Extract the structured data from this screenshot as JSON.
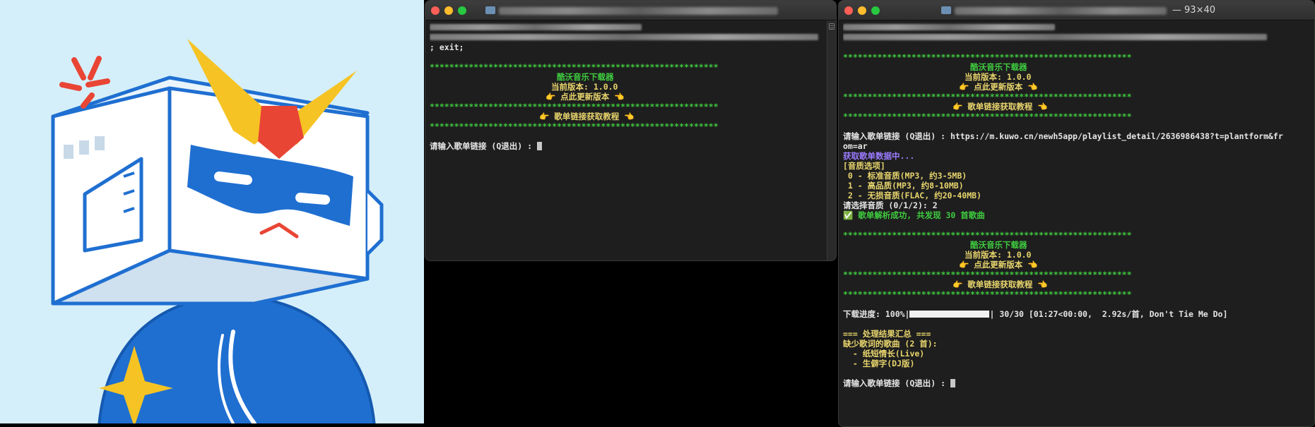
{
  "terminal_left": {
    "prev_command_tail": "; exit;",
    "banner": {
      "stars": "***********************************************************",
      "app_name": "酷沃音乐下载器",
      "version_line": "当前版本: 1.0.0",
      "update_link": "👉 点此更新版本 👈",
      "tutorial_link": "👉 歌单链接获取教程 👈"
    },
    "prompt": "请输入歌单链接 (Q退出) : "
  },
  "terminal_right": {
    "size_label": "— 93×40",
    "banner": {
      "stars": "***********************************************************",
      "app_name": "酷沃音乐下载器",
      "version_line": "当前版本: 1.0.0",
      "update_link": "👉 点此更新版本 👈",
      "tutorial_link": "👉 歌单链接获取教程 👈"
    },
    "prompt_with_url": "请输入歌单链接 (Q退出) : https://m.kuwo.cn/newh5app/playlist_detail/2636986438?t=plantform&fr",
    "url_wrap": "om=ar",
    "fetching": "获取歌单数据中...",
    "quality_header": "[音质选项]",
    "quality_options": [
      " 0 - 标准音质(MP3, 约3-5MB)",
      " 1 - 高品质(MP3, 约8-10MB)",
      " 2 - 无损音质(FLAC, 约20-40MB)"
    ],
    "quality_prompt": "请选择音质 (0/1/2): 2",
    "parse_success": "✅ 歌单解析成功, 共发现 30 首歌曲",
    "progress_prefix": "下载进度: 100%|",
    "progress_suffix": "| 30/30 [01:27<00:00,  2.92s/首, Don't Tie Me Do]",
    "summary_header": "=== 处理结果汇总 ===",
    "missing_lyrics_header": "缺少歌词的歌曲 (2 首):",
    "missing_lyrics": [
      "  - 纸短情长(Live)",
      "  - 生僻字(DJ版)"
    ],
    "prompt": "请输入歌单链接 (Q退出) : "
  },
  "colors": {
    "green": "#3fcb3f",
    "yellow": "#e8d56d",
    "purple": "#9b7bff",
    "terminal_bg": "#1e1e1e",
    "mascot_bg": "#d4effa",
    "mascot_blue": "#1f6fd1",
    "mascot_yellow": "#f6c324",
    "mascot_red": "#e94535"
  },
  "icons": {
    "mascot": "robot-box-head-mascot-illustration",
    "anger": "anger-symbol-icon",
    "folder": "folder-icon"
  }
}
